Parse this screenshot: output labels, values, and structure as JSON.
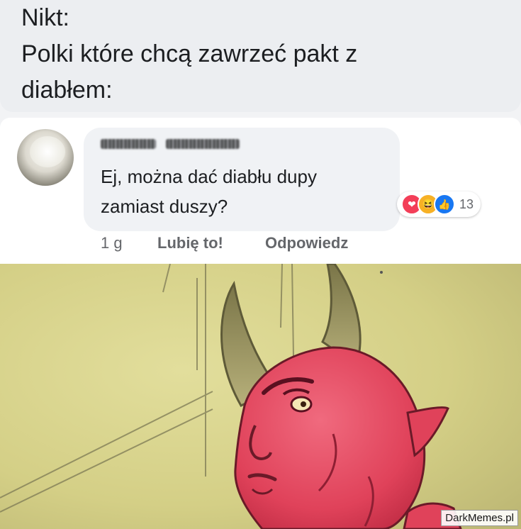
{
  "post": {
    "line1": "Nikt:",
    "line2": "Polki które chcą zawrzeć pakt z",
    "line3": "diabłem:"
  },
  "comment": {
    "text_line1": "Ej, można dać diabłu dupy",
    "text_line2": "zamiast duszy?",
    "reactions": {
      "icons": [
        "love-icon",
        "haha-icon",
        "like-icon"
      ],
      "count": "13"
    },
    "actions": {
      "time": "1 g",
      "like": "Lubię to!",
      "reply": "Odpowiedz"
    }
  },
  "watermark": {
    "part1": "Dark",
    "part2": "Memes.pl"
  },
  "colors": {
    "devil": "#e0425a",
    "background": "#d8d48e",
    "horn": "#8f8a57"
  }
}
